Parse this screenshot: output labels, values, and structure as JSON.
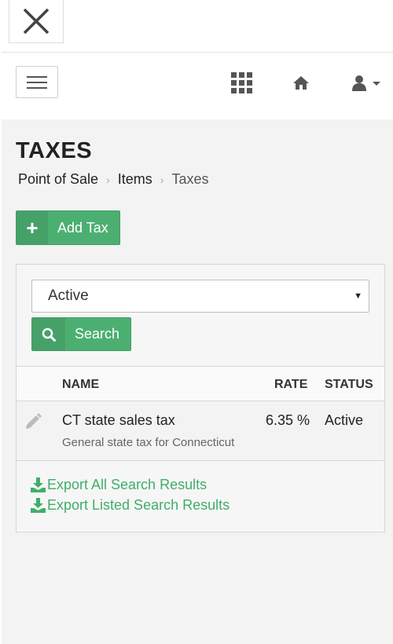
{
  "header": {
    "close_icon": "close-icon",
    "menu_icon": "hamburger-menu-icon",
    "apps_icon": "grid-icon",
    "home_icon": "home-icon",
    "user_icon": "user-icon"
  },
  "page": {
    "title": "TAXES",
    "breadcrumb": [
      "Point of Sale",
      "Items",
      "Taxes"
    ]
  },
  "toolbar": {
    "add_label": "Add Tax"
  },
  "filters": {
    "status_selected": "Active",
    "search_label": "Search"
  },
  "table": {
    "columns": [
      "NAME",
      "RATE",
      "STATUS"
    ],
    "rows": [
      {
        "name": "CT state sales tax",
        "description": "General state tax for Connecticut",
        "rate": "6.35 %",
        "status": "Active"
      }
    ]
  },
  "export": {
    "all_label": "Export All Search Results",
    "listed_label": "Export Listed Search Results"
  },
  "colors": {
    "accent_green": "#4caf72",
    "link_green": "#3fae6a",
    "background": "#f3f3f3"
  }
}
